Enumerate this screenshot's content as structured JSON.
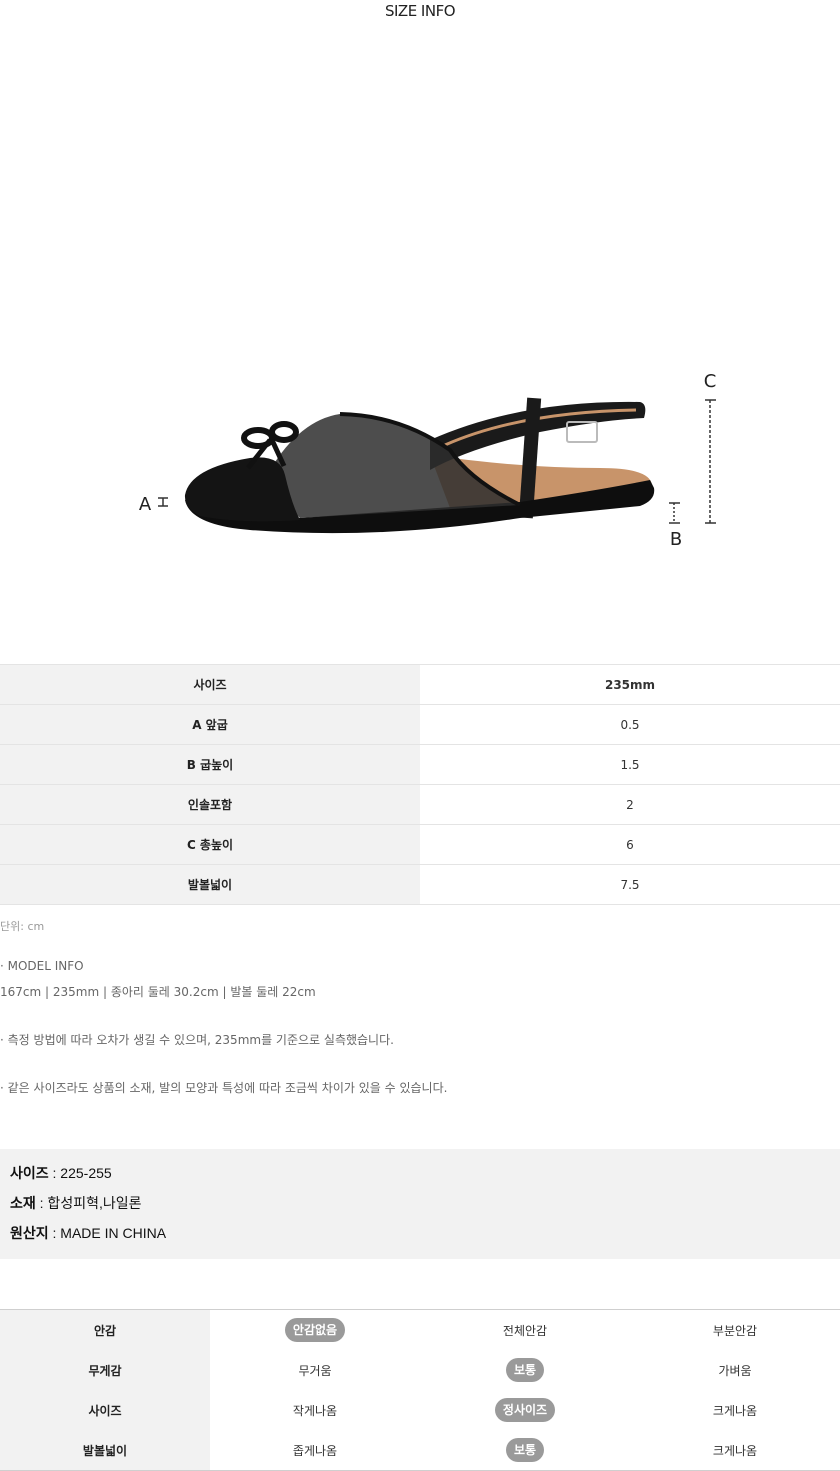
{
  "header": {
    "title": "SIZE INFO"
  },
  "figure": {
    "label_a": "A",
    "label_b": "B",
    "label_c": "C"
  },
  "size_table": {
    "rows": [
      {
        "label": "사이즈",
        "value": "235mm"
      },
      {
        "label": "A 앞굽",
        "value": "0.5"
      },
      {
        "label": "B 굽높이",
        "value": "1.5"
      },
      {
        "label": "인솔포함",
        "value": "2"
      },
      {
        "label": "C 총높이",
        "value": "6"
      },
      {
        "label": "발볼넓이",
        "value": "7.5"
      }
    ]
  },
  "notes": {
    "unit": "단위: cm",
    "model_title": "· MODEL INFO",
    "model_detail": "167cm | 235mm | 종아리 둘레 30.2cm | 발볼 둘레 22cm",
    "measure_note": "· 측정 방법에 따라 오차가 생길 수 있으며, 235mm를 기준으로 실측했습니다.",
    "variance_note": "· 같은 사이즈라도 상품의 소재, 발의 모양과 특성에 따라 조금씩 차이가 있을 수 있습니다."
  },
  "specs": [
    {
      "key": "사이즈",
      "value": " : 225-255"
    },
    {
      "key": "소재",
      "value": " : 합성피혁,나일론"
    },
    {
      "key": "원산지",
      "value": " : MADE IN CHINA"
    }
  ],
  "feel_table": {
    "rows": [
      {
        "label": "안감",
        "options": [
          "안감없음",
          "전체안감",
          "부분안감"
        ],
        "selected": 0
      },
      {
        "label": "무게감",
        "options": [
          "무거움",
          "보통",
          "가벼움"
        ],
        "selected": 1
      },
      {
        "label": "사이즈",
        "options": [
          "작게나옴",
          "정사이즈",
          "크게나옴"
        ],
        "selected": 1
      },
      {
        "label": "발볼넓이",
        "options": [
          "좁게나옴",
          "보통",
          "크게나옴"
        ],
        "selected": 1
      }
    ]
  },
  "colors": {
    "pill_bg": "#9a9a9a",
    "key_bg": "#f2f2f2",
    "shoe": "#151515",
    "lining": "#c8946a"
  }
}
